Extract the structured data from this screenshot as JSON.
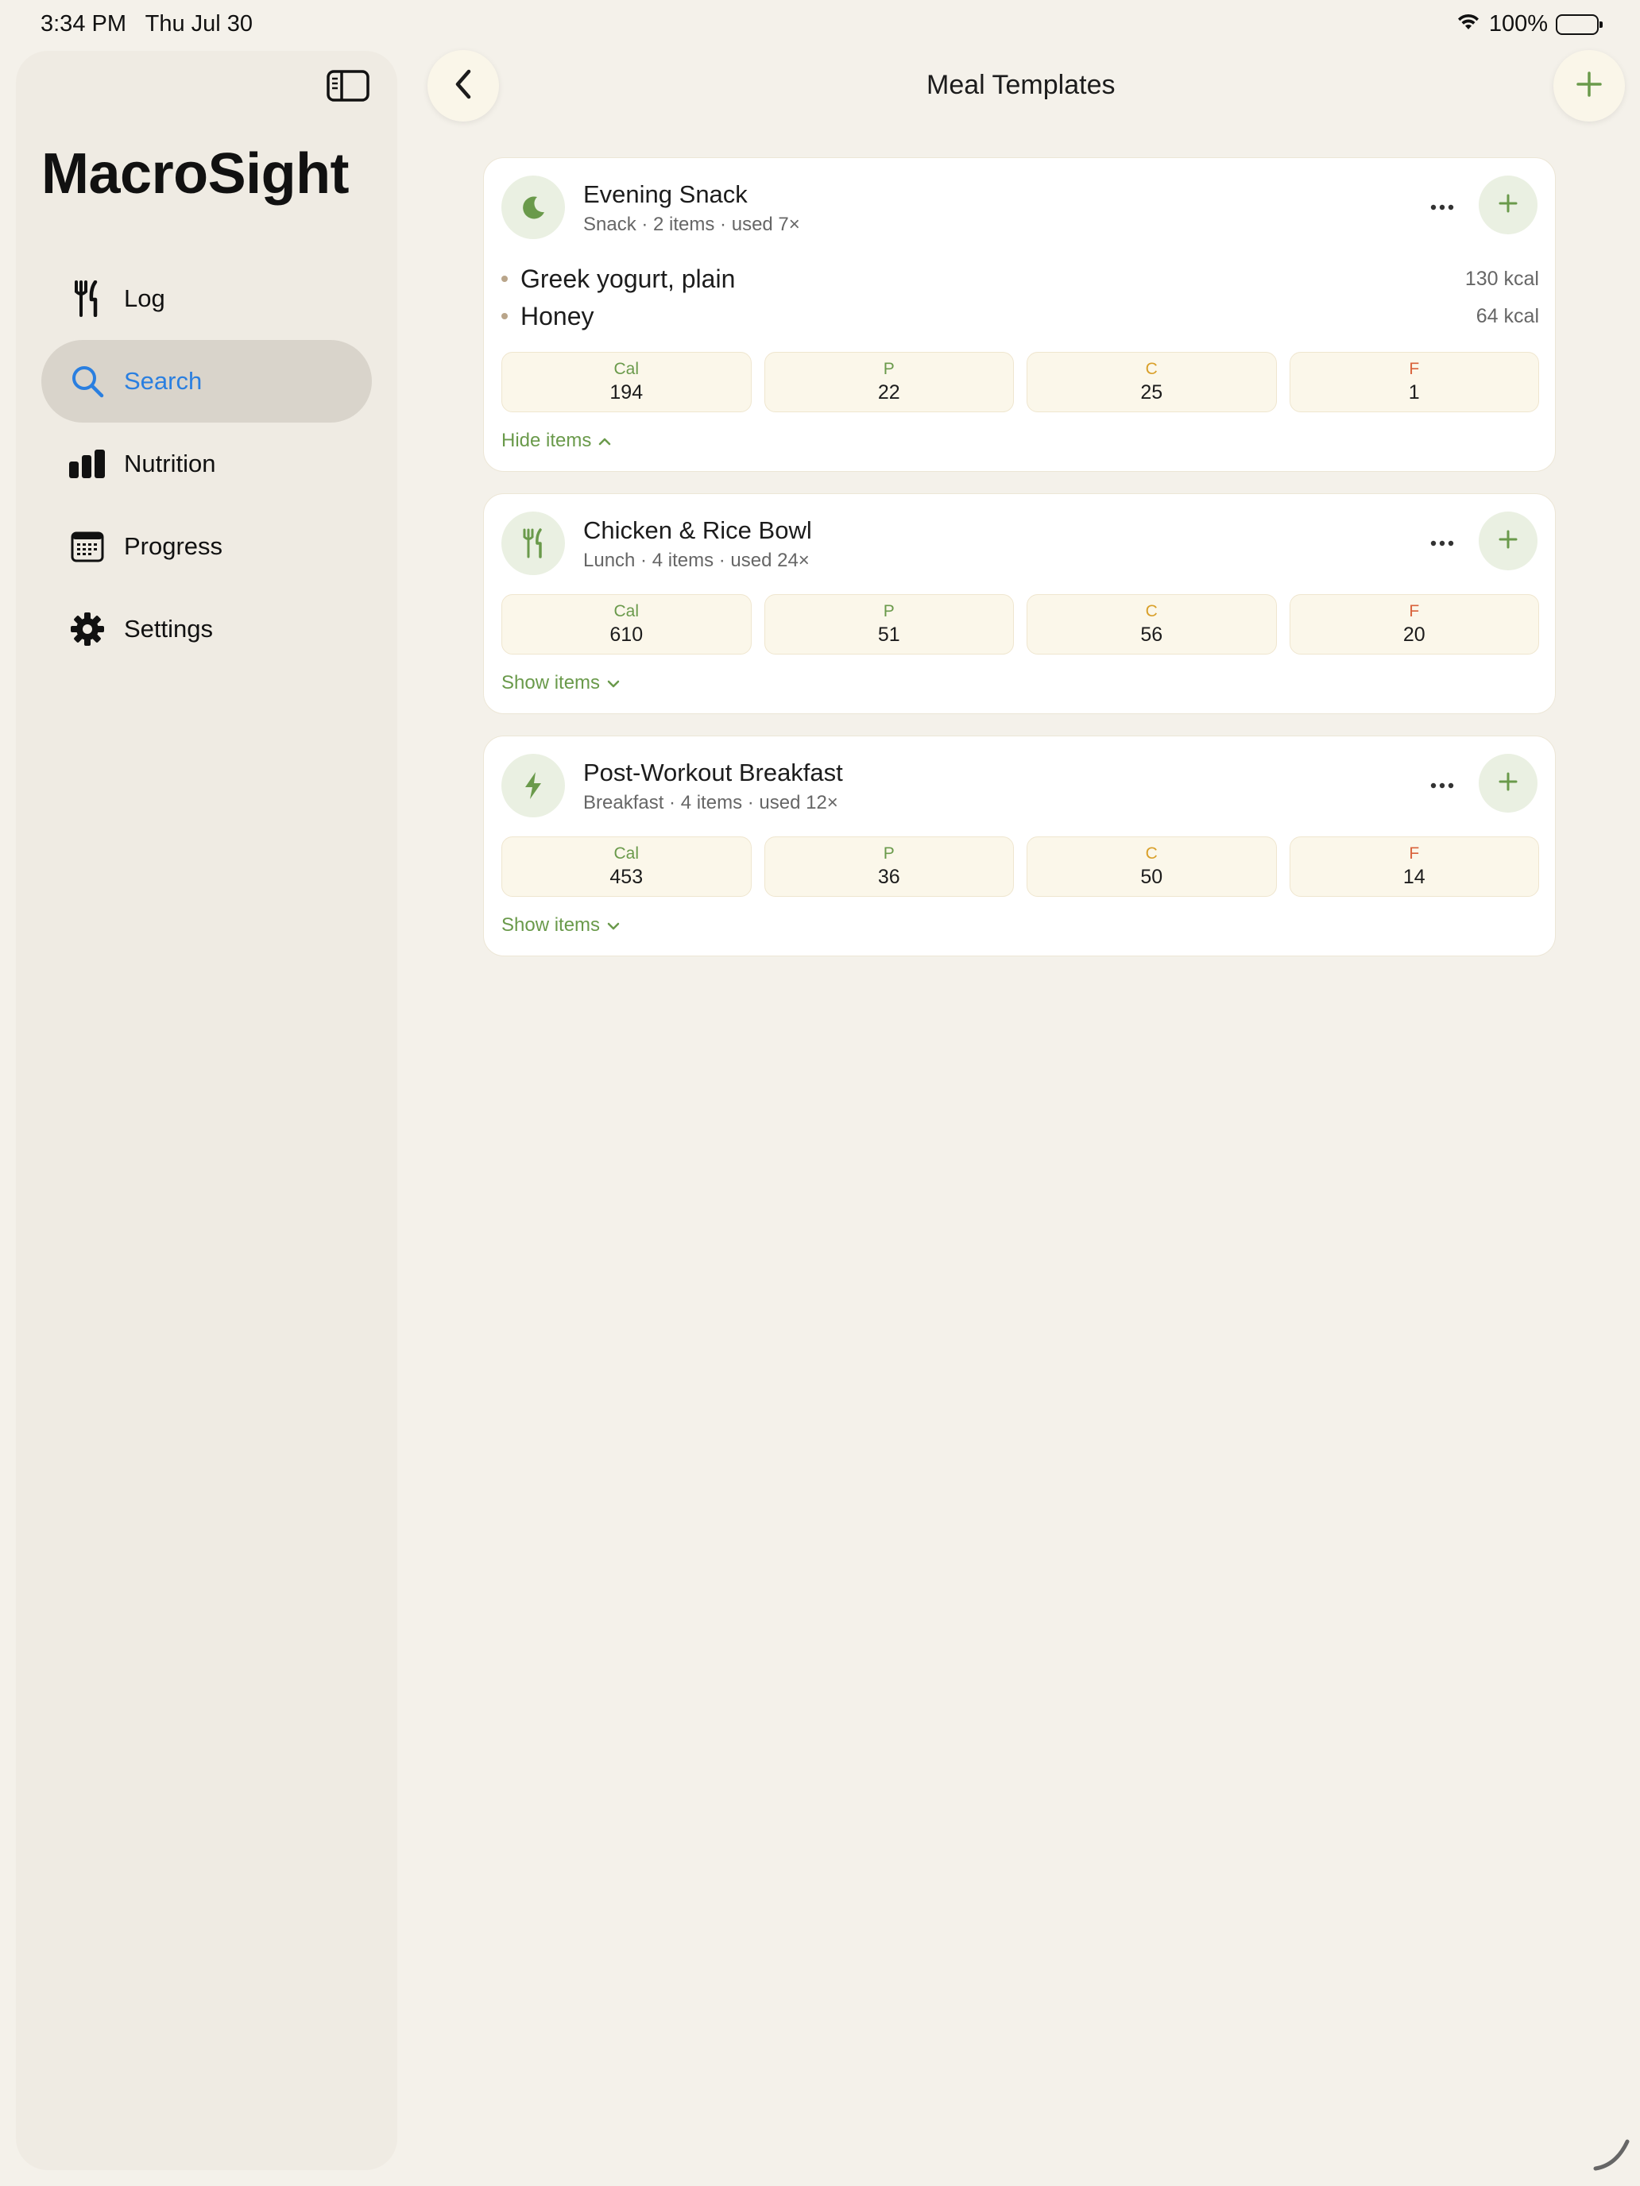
{
  "colors": {
    "background": "#f4f1ea",
    "sidebar": "#efebe3",
    "accent_green": "#6a9a4b",
    "accent_blue": "#2a7fe0",
    "cal_label": "#6a9a4b",
    "protein_label": "#6a9a4b",
    "carb_label": "#d9a02a",
    "fat_label": "#d9623b"
  },
  "status_bar": {
    "time": "3:34 PM   Thu Jul 30",
    "battery": "100%",
    "icons": [
      "wifi-icon",
      "battery-icon"
    ]
  },
  "sidebar": {
    "toggle_icon": "sidebar-toggle-icon",
    "app_title": "MacroSight",
    "items": [
      {
        "label": "Log",
        "icon": "fork-knife-icon",
        "active": false
      },
      {
        "label": "Search",
        "icon": "search-icon",
        "active": true
      },
      {
        "label": "Nutrition",
        "icon": "bar-chart-icon",
        "active": false
      },
      {
        "label": "Progress",
        "icon": "calendar-icon",
        "active": false
      },
      {
        "label": "Settings",
        "icon": "gear-icon",
        "active": false
      }
    ]
  },
  "header": {
    "title": "Meal Templates",
    "back_icon": "chevron-left-icon",
    "add_icon": "plus-icon"
  },
  "templates": [
    {
      "name": "Evening Snack",
      "meta": "Snack · 2 items · used 7×",
      "icon": "moon-icon",
      "expanded": true,
      "items": [
        {
          "name": "Greek yogurt, plain",
          "kcal": "130 kcal"
        },
        {
          "name": "Honey",
          "kcal": "64 kcal"
        }
      ],
      "macros": {
        "cal_label": "Cal",
        "cal": "194",
        "p_label": "P",
        "p": "22",
        "c_label": "C",
        "c": "25",
        "f_label": "F",
        "f": "1"
      },
      "toggle_label": "Hide items"
    },
    {
      "name": "Chicken & Rice Bowl",
      "meta": "Lunch · 4 items · used 24×",
      "icon": "fork-knife-icon",
      "expanded": false,
      "macros": {
        "cal_label": "Cal",
        "cal": "610",
        "p_label": "P",
        "p": "51",
        "c_label": "C",
        "c": "56",
        "f_label": "F",
        "f": "20"
      },
      "toggle_label": "Show items"
    },
    {
      "name": "Post-Workout Breakfast",
      "meta": "Breakfast · 4 items · used 12×",
      "icon": "bolt-icon",
      "expanded": false,
      "macros": {
        "cal_label": "Cal",
        "cal": "453",
        "p_label": "P",
        "p": "36",
        "c_label": "C",
        "c": "50",
        "f_label": "F",
        "f": "14"
      },
      "toggle_label": "Show items"
    }
  ]
}
